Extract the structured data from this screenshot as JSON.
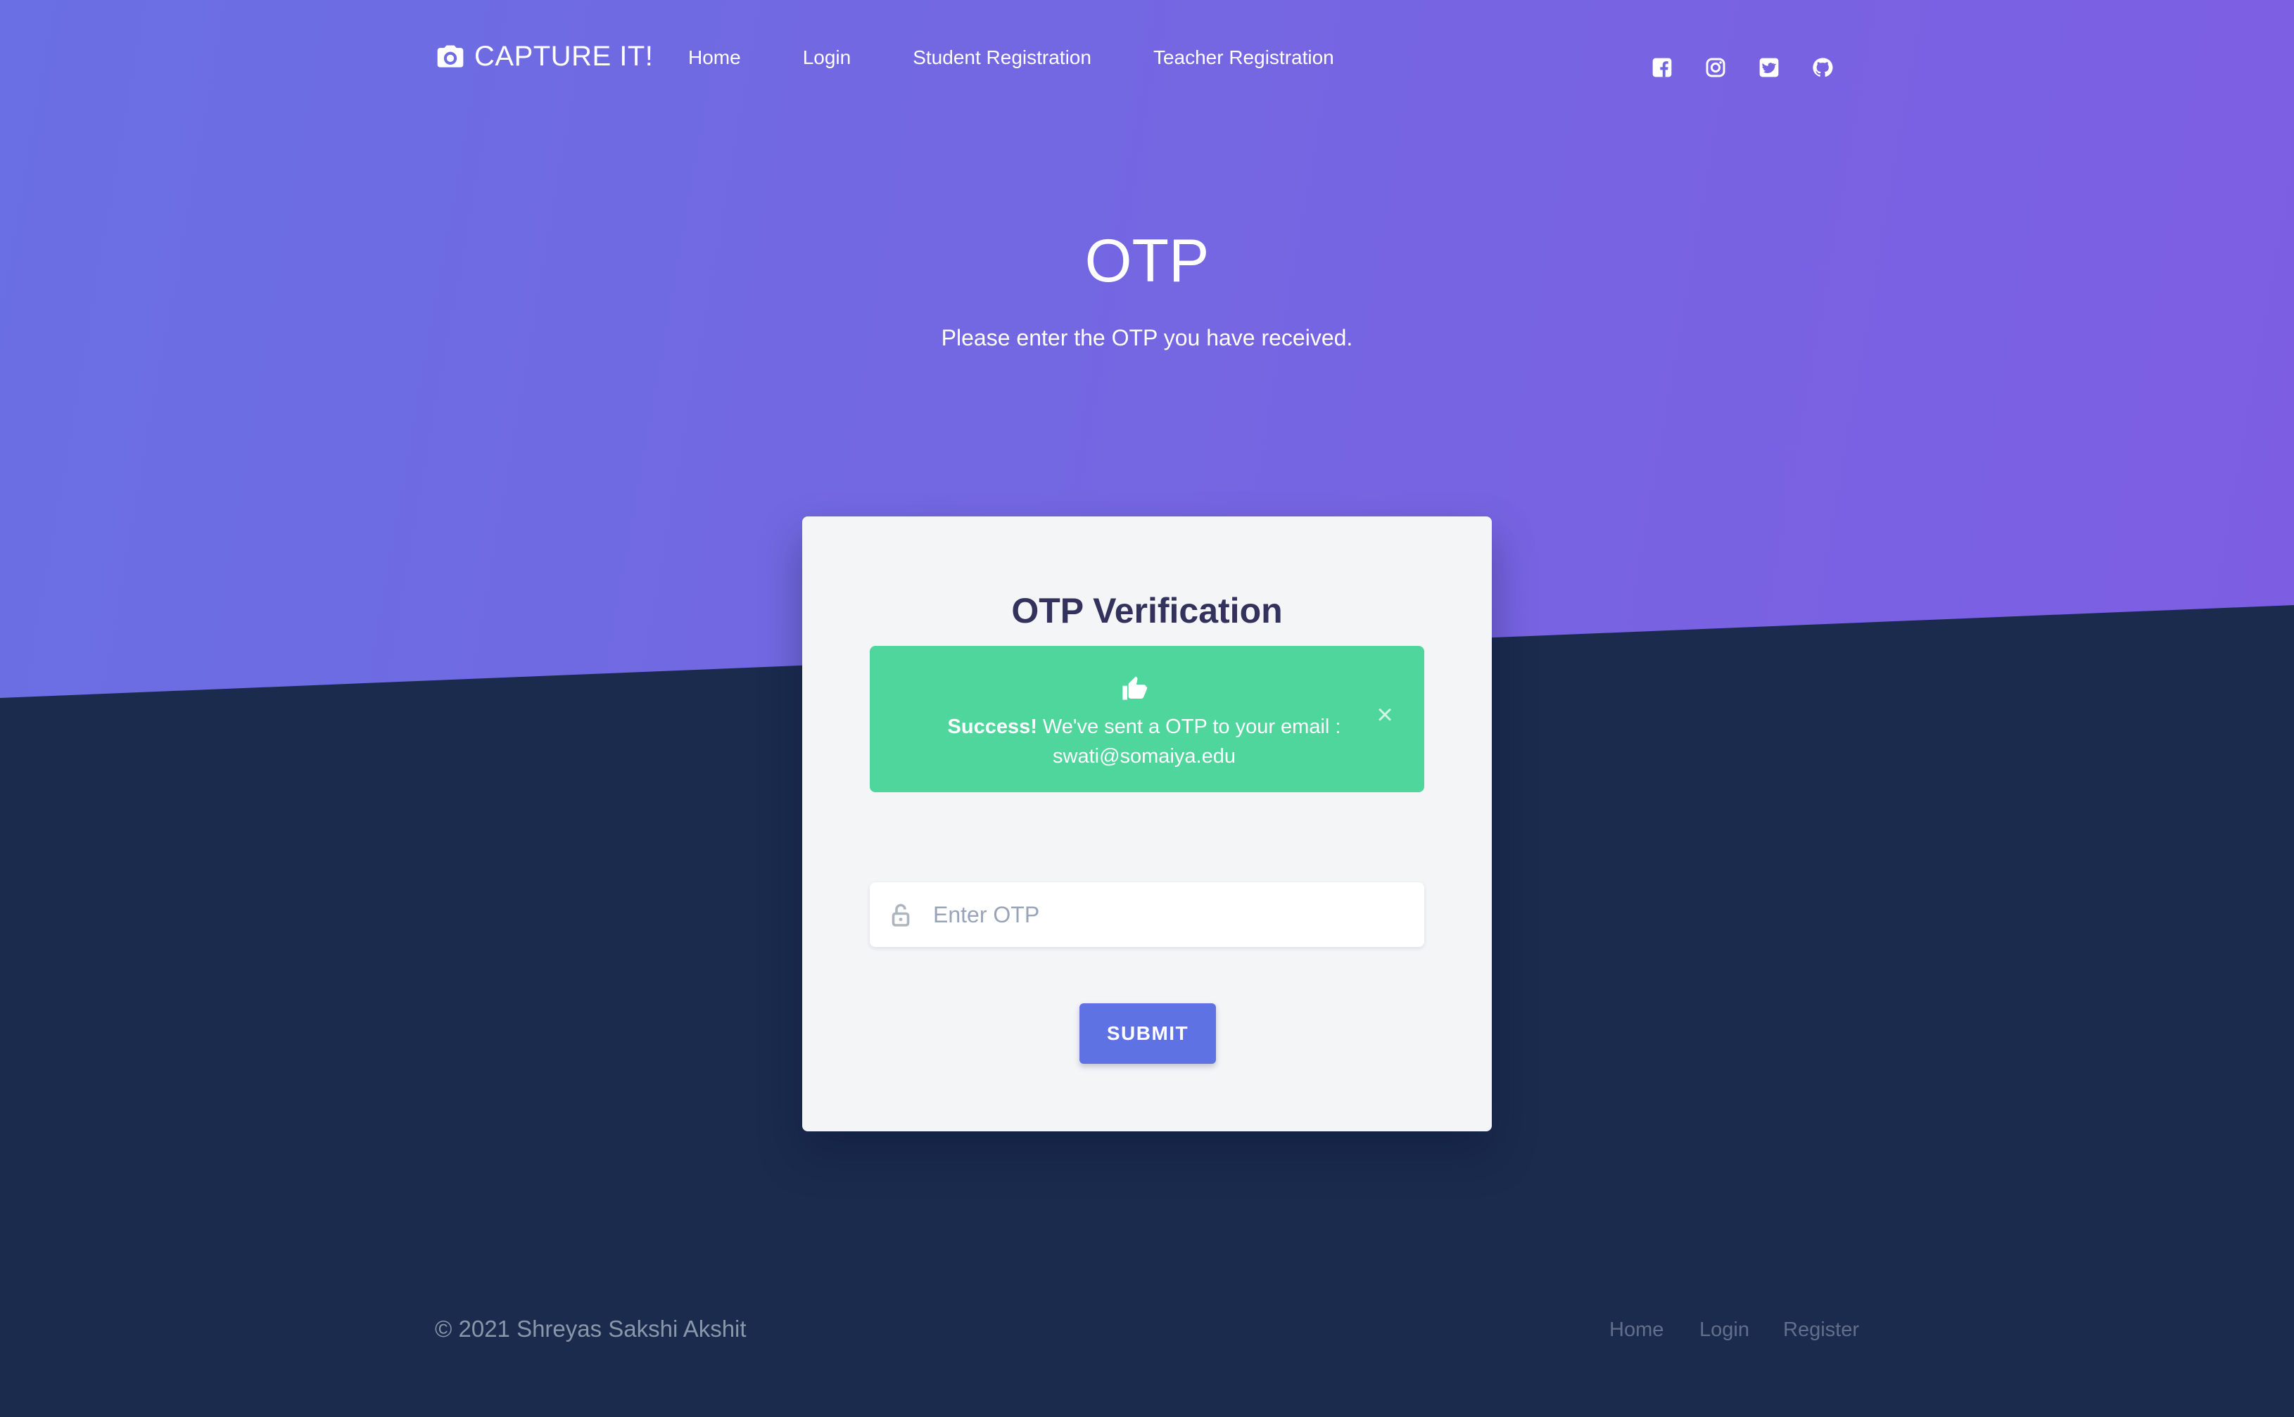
{
  "navbar": {
    "brand": "CAPTURE IT!",
    "brand_icon": "camera-icon",
    "links": [
      {
        "label": "Home"
      },
      {
        "label": "Login"
      },
      {
        "label": "Student Registration"
      },
      {
        "label": "Teacher Registration"
      }
    ],
    "social_icons": [
      "facebook-icon",
      "instagram-icon",
      "twitter-icon",
      "github-icon"
    ]
  },
  "hero": {
    "title": "OTP",
    "subtitle": "Please enter the OTP you have received."
  },
  "card": {
    "title": "OTP Verification",
    "alert": {
      "icon": "thumbs-up-icon",
      "strong": "Success!",
      "message": " We've sent a OTP to your email :",
      "email": "swati@somaiya.edu",
      "close": "×",
      "color": "#4fd69c"
    },
    "otp_input": {
      "placeholder": "Enter OTP",
      "value": "",
      "icon": "lock-icon"
    },
    "submit_label": "SUBMIT",
    "accent": "#5e72e4"
  },
  "footer": {
    "copyright": "© 2021 Shreyas Sakshi Akshit",
    "links": [
      {
        "label": "Home"
      },
      {
        "label": "Login"
      },
      {
        "label": "Register"
      }
    ]
  },
  "colors": {
    "gradient_start": "#6a6fe3",
    "gradient_end": "#7d5ee3",
    "background_dark": "#1a2b4e",
    "card_bg": "#f4f5f7"
  }
}
